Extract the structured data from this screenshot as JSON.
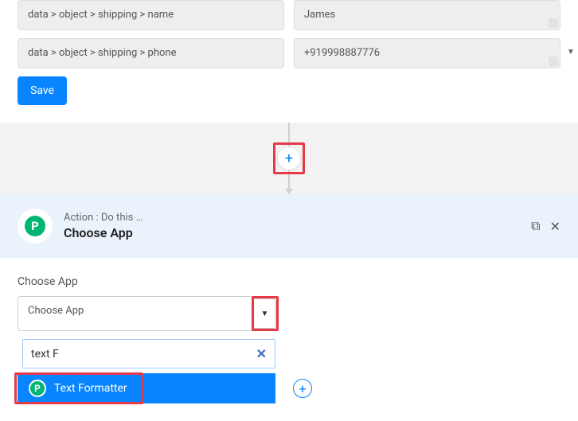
{
  "fields": {
    "row1_path": "data > object > shipping > name",
    "row1_value": "James",
    "row2_path": "data > object > shipping > phone",
    "row2_value": "+919998887776"
  },
  "buttons": {
    "save": "Save"
  },
  "action": {
    "label": "Action : Do this …",
    "title": "Choose App"
  },
  "choose": {
    "label": "Choose App",
    "placeholder": "Choose App",
    "search_value": "text F",
    "result": "Text Formatter"
  },
  "icons": {
    "plus": "+",
    "caret": "▼",
    "clear": "✕",
    "copy": "⧉",
    "close": "✕"
  }
}
